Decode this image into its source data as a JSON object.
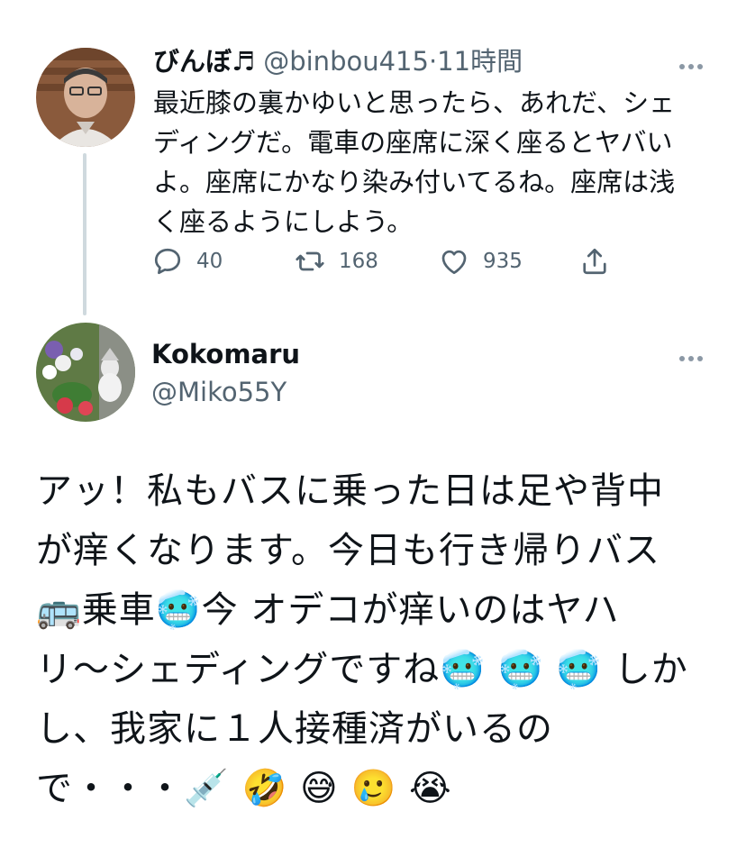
{
  "tweet1": {
    "name": "びんぼ♬",
    "handle": "@binbou415",
    "separator": "·",
    "time": "11時間",
    "text": "最近膝の裏かゆいと思ったら、あれだ、シェ\nディングだ。電車の座席に深く座るとヤバい\nよ。座席にかなり染み付いてるね。座席は浅\nく座るようにしよう。",
    "reply_count": "40",
    "retweet_count": "168",
    "like_count": "935",
    "icons": [
      "reply-icon",
      "retweet-icon",
      "like-icon",
      "share-icon",
      "more-icon"
    ]
  },
  "tweet2": {
    "name": "Kokomaru",
    "handle": "@Miko55Y",
    "text": "アッ！私もバスに乗った日は足や背中\nが痒くなります。今日も行き帰りバス\n🚌乗車🥶今 オデコが痒いのはヤハ\nリ〜シェディングですね🥶 🥶 🥶 しか\nし、我家に１人接種済がいるの\nで・・・💉 🤣 😅 🥲 😭"
  },
  "colors": {
    "text": "#0f1419",
    "muted": "#536471",
    "line": "#cfd9de"
  }
}
